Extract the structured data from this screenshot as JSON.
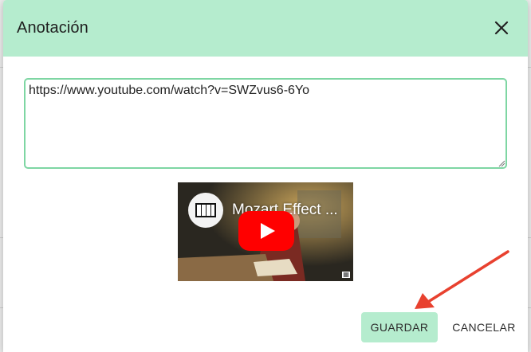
{
  "dialog": {
    "title": "Anotación",
    "url_value": "https://www.youtube.com/watch?v=SWZvus6-6Yo",
    "save_label": "GUARDAR",
    "cancel_label": "CANCELAR"
  },
  "video": {
    "title": "Mozart Effect ..."
  },
  "colors": {
    "header_bg": "#b5ecce",
    "input_border": "#7ed6a3",
    "save_bg": "#b5ecce",
    "play_red": "#ff0000",
    "annotation_arrow": "#e8412f"
  }
}
